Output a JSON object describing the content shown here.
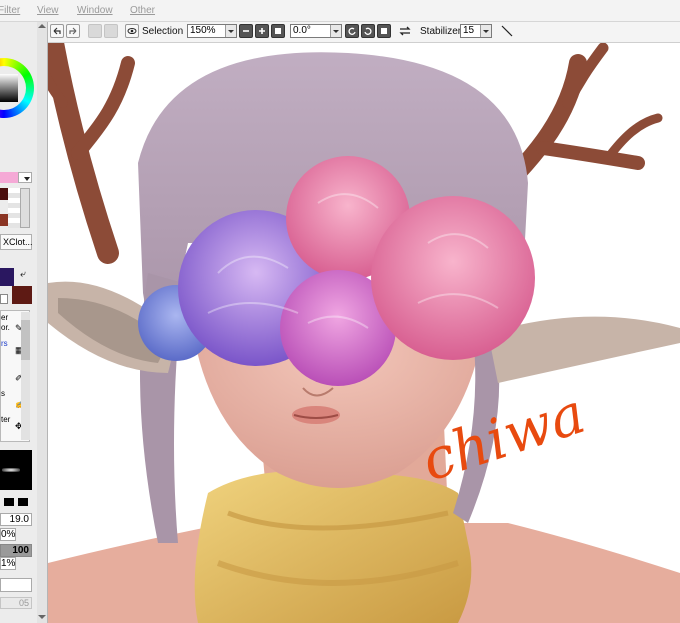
{
  "menu": {
    "filter": "Filter",
    "view": "View",
    "window": "Window",
    "other": "Other"
  },
  "toolbar": {
    "selection_label": "Selection",
    "zoom_value": "150%",
    "rotation_value": "0.0°",
    "stabilizer_label": "Stabilizer",
    "stabilizer_value": "15"
  },
  "left_panel": {
    "layer_name": "XClot...",
    "tool_labels": [
      "er",
      "or.",
      "rs",
      "s",
      "ter"
    ],
    "brush_size": "19.0",
    "zoom_pct_partial": "0%",
    "density_value": "100",
    "pct_partial": "1%",
    "bottom_value": "05"
  },
  "canvas": {
    "signature": "chiwa"
  },
  "colors": {
    "primary_color": "#2a1760",
    "secondary_color": "#5e1a14",
    "swatch_pink": "#f5a9d6",
    "hair": "#b8a5b9",
    "antler": "#8c4b37",
    "skin": "#ebb6a8",
    "scarf": "#e3c064",
    "signature_color": "#e84a0f"
  }
}
